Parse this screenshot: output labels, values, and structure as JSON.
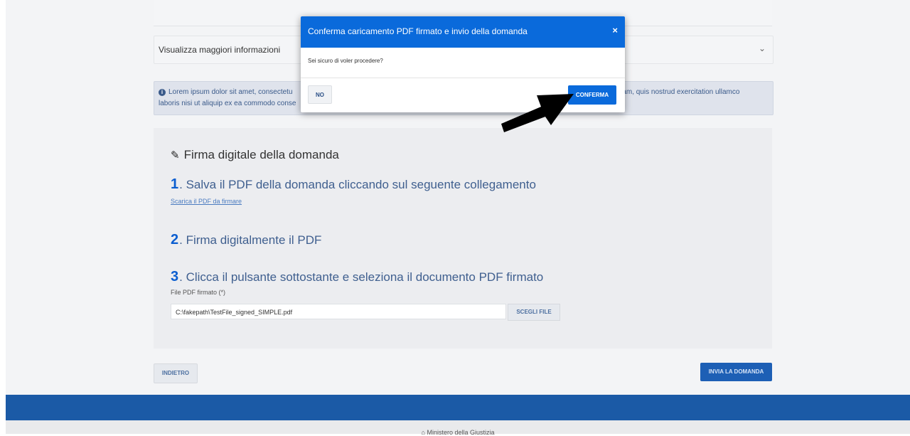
{
  "accordion": {
    "label": "Visualizza maggiori informazioni"
  },
  "info_alert": {
    "line1": "Lorem ipsum dolor sit amet, consectetu",
    "line1_end": "veniam, quis nostrud exercitation ullamco",
    "line2": "laboris nisi ut aliquip ex ea commodo conse"
  },
  "sign_section": {
    "title": "Firma digitale della domanda",
    "step1_num": "1",
    "step1_text": ". Salva il PDF della domanda cliccando sul seguente collegamento",
    "download_link": "Scarica il PDF da firmare",
    "step2_num": "2",
    "step2_text": ". Firma digitalmente il PDF",
    "step3_num": "3",
    "step3_text": ". Clicca il pulsante sottostante e seleziona il documento PDF firmato",
    "file_label": "File PDF firmato (*)",
    "file_value": "C:\\fakepath\\TestFile_signed_SIMPLE.pdf",
    "file_button": "SCEGLI FILE"
  },
  "actions": {
    "back": "INDIETRO",
    "submit": "INVIA LA DOMANDA"
  },
  "footer": {
    "text": "Ministero della Giustizia"
  },
  "modal": {
    "title": "Conferma caricamento PDF firmato e invio della domanda",
    "close": "×",
    "body": "Sei sicuro di voler procedere?",
    "no": "NO",
    "confirm": "CONFERMA"
  },
  "colors": {
    "primary": "#0a6adb",
    "footer": "#1b5aa6",
    "background": "#f3f4f6"
  }
}
